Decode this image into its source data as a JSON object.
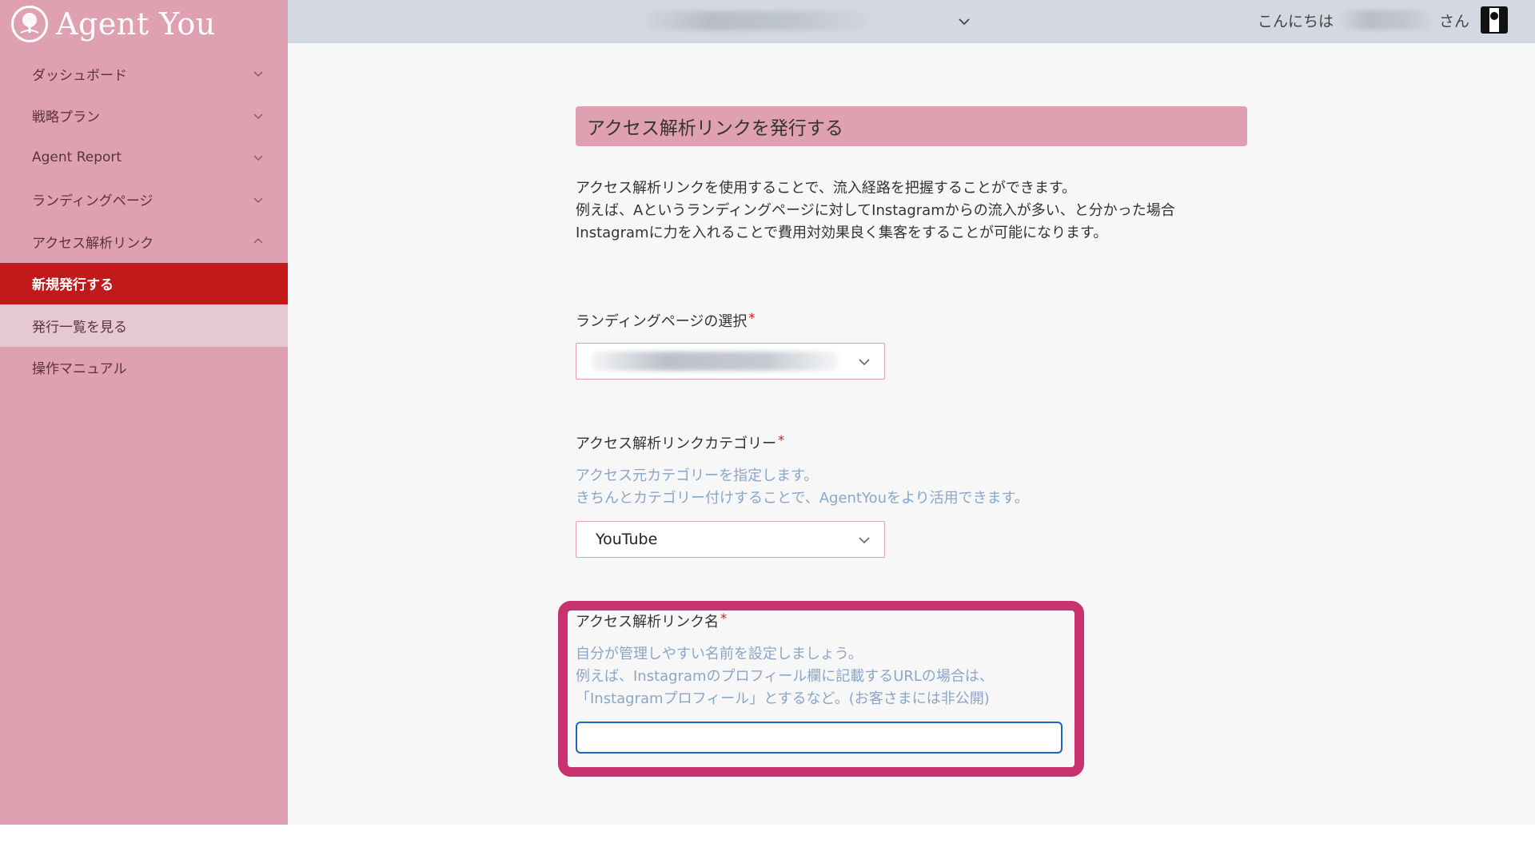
{
  "app": {
    "logo_text": "Agent You"
  },
  "sidebar": {
    "items": [
      {
        "label": "ダッシュボード",
        "chevron": "down"
      },
      {
        "label": "戦略プラン",
        "chevron": "down"
      },
      {
        "label": "Agent Report",
        "chevron": "down"
      },
      {
        "label": "ランディングページ",
        "chevron": "down"
      },
      {
        "label": "アクセス解析リンク",
        "chevron": "up"
      },
      {
        "label": "新規発行する",
        "state": "active"
      },
      {
        "label": "発行一覧を見る",
        "state": "sub"
      },
      {
        "label": "操作マニュアル"
      }
    ]
  },
  "header": {
    "greeting_prefix": "こんにちは",
    "greeting_suffix": "さん"
  },
  "main": {
    "title": "アクセス解析リンクを発行する",
    "intro_lines": [
      "アクセス解析リンクを使用することで、流入経路を把握することができます。",
      "例えば、Aというランディングページに対してInstagramからの流入が多い、と分かった場合",
      "Instagramに力を入れることで費用対効果良く集客をすることが可能になります。"
    ],
    "lp_select": {
      "label": "ランディングページの選択",
      "required_mark": "*"
    },
    "category": {
      "label": "アクセス解析リンクカテゴリー",
      "required_mark": "*",
      "help_lines": [
        "アクセス元カテゴリーを指定します。",
        "きちんとカテゴリー付けすることで、AgentYouをより活用できます。"
      ],
      "selected": "YouTube"
    },
    "link_name": {
      "label": "アクセス解析リンク名",
      "required_mark": "*",
      "help_lines": [
        "自分が管理しやすい名前を設定しましょう。",
        "例えば、Instagramのプロフィール欄に記載するURLの場合は、",
        "「Instagramプロフィール」とするなど。(お客さまには非公開)"
      ],
      "value": ""
    }
  },
  "colors": {
    "sidebar_bg": "#dfa0b2",
    "active_bg": "#c21a1a",
    "highlight": "#c8326e",
    "help_text": "#8aa6c8"
  }
}
